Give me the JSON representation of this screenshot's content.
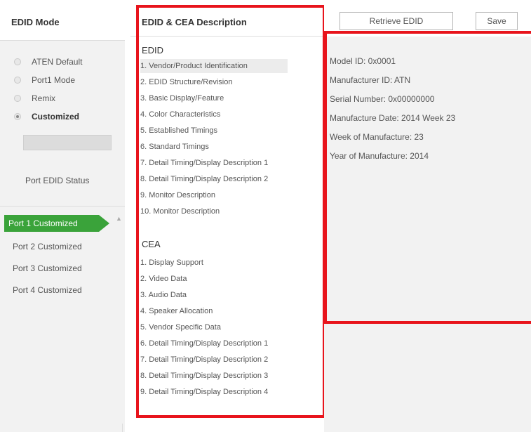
{
  "left_panel": {
    "title": "EDID Mode",
    "modes": [
      {
        "label": "ATEN Default",
        "checked": false
      },
      {
        "label": "Port1 Mode",
        "checked": false
      },
      {
        "label": "Remix",
        "checked": false
      },
      {
        "label": "Customized",
        "checked": true
      }
    ],
    "port_status_label": "Port EDID Status",
    "ports": [
      {
        "label": "Port 1  Customized",
        "active": true
      },
      {
        "label": "Port 2  Customized",
        "active": false
      },
      {
        "label": "Port 3  Customized",
        "active": false
      },
      {
        "label": "Port 4  Customized",
        "active": false
      }
    ]
  },
  "middle_panel": {
    "title": "EDID & CEA Description",
    "edid_heading": "EDID",
    "edid_items": [
      "1.  Vendor/Product Identification",
      "2.  EDID Structure/Revision",
      "3.  Basic Display/Feature",
      "4.  Color Characteristics",
      "5.  Established Timings",
      "6.  Standard Timings",
      "7.  Detail Timing/Display Description 1",
      "8.  Detail Timing/Display Description 2",
      "9.  Monitor Description",
      "10.  Monitor Description"
    ],
    "cea_heading": "CEA",
    "cea_items": [
      "1.  Display Support",
      "2.  Video Data",
      "3.  Audio Data",
      "4.  Speaker Allocation",
      "5.  Vendor Specific Data",
      "6.  Detail Timing/Display Description 1",
      "7.  Detail Timing/Display Description 2",
      "8.  Detail Timing/Display Description 3",
      "9.  Detail Timing/Display Description 4"
    ]
  },
  "toolbar": {
    "retrieve_label": "Retrieve EDID",
    "save_label": "Save"
  },
  "details": [
    "Model ID: 0x0001",
    "Manufacturer ID: ATN",
    "Serial Number: 0x00000000",
    "Manufacture Date: 2014 Week 23",
    "Week of Manufacture: 23",
    "Year of Manufacture: 2014"
  ],
  "colors": {
    "highlight_frame": "#e8141c",
    "active_port": "#3aa33a"
  }
}
